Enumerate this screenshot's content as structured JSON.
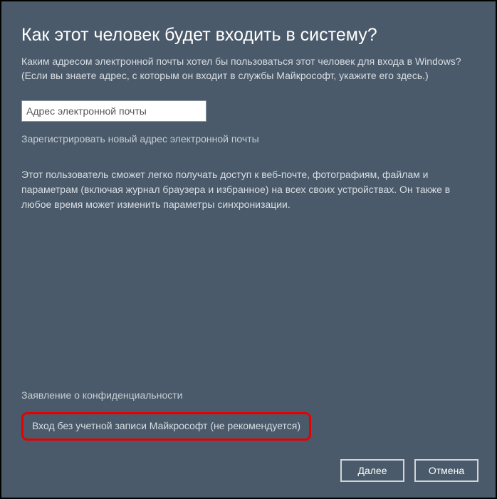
{
  "title": "Как этот человек будет входить в систему?",
  "subtitle": "Каким адресом электронной почты хотел бы пользоваться этот человек для входа в Windows? (Если вы знаете адрес, с которым он входит в службы Майкрософт, укажите его здесь.)",
  "email": {
    "placeholder": "Адрес электронной почты",
    "value": ""
  },
  "links": {
    "register_new_email": "Зарегистрировать новый адрес электронной почты",
    "privacy": "Заявление о конфиденциальности",
    "no_ms_account": "Вход без учетной записи Майкрософт (не рекомендуется)"
  },
  "description": "Этот пользователь сможет легко получать доступ к веб-почте, фотографиям, файлам и параметрам (включая журнал браузера и избранное) на всех своих устройствах. Он также в любое время может изменить параметры синхронизации.",
  "buttons": {
    "next": "Далее",
    "cancel": "Отмена"
  }
}
